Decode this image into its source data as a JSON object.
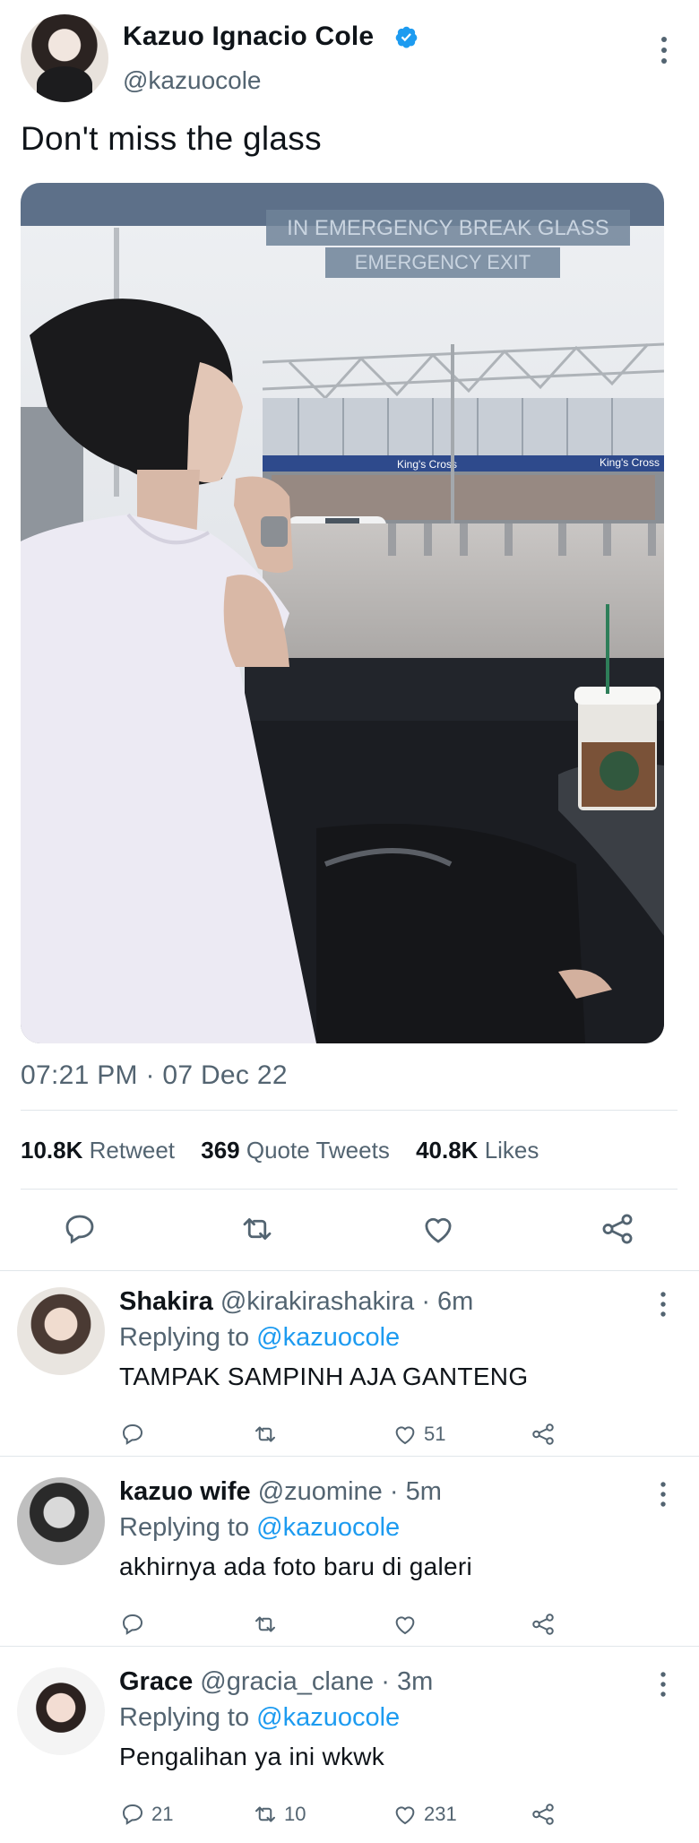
{
  "tweet": {
    "author_name": "Kazuo Ignacio Cole",
    "author_handle": "@kazuocole",
    "text": "Don't miss the glass",
    "photo_sign_1": "IN EMERGENCY BREAK GLASS",
    "photo_sign_2": "EMERGENCY EXIT",
    "photo_station_1": "King's Cross",
    "photo_station_2": "King's Cross",
    "timestamp": "07:21 PM · 07 Dec 22",
    "stats": {
      "retweets_count": "10.8K",
      "retweets_label": "Retweet",
      "quotes_count": "369",
      "quotes_label": "Quote Tweets",
      "likes_count": "40.8K",
      "likes_label": "Likes"
    },
    "icons": [
      "reply-icon",
      "retweet-icon",
      "like-icon",
      "share-icon",
      "verified-icon",
      "more-icon"
    ]
  },
  "replies": [
    {
      "name": "Shakira",
      "handle": "@kirakirashakira",
      "dot": "·",
      "time": "6m",
      "replying_label": "Replying to",
      "replying_to": "@kazuocole",
      "text": "TAMPAK SAMPINH AJA GANTENG",
      "reply_count": "",
      "retweet_count": "",
      "like_count": "51"
    },
    {
      "name": "kazuo wife",
      "handle": "@zuomine",
      "dot": "·",
      "time": "5m",
      "replying_label": "Replying to",
      "replying_to": "@kazuocole",
      "text": "akhirnya ada foto baru di galeri",
      "reply_count": "",
      "retweet_count": "",
      "like_count": ""
    },
    {
      "name": "Grace",
      "handle": "@gracia_clane",
      "dot": "·",
      "time": "3m",
      "replying_label": "Replying to",
      "replying_to": "@kazuocole",
      "text": "Pengalihan ya ini wkwk",
      "reply_count": "21",
      "retweet_count": "10",
      "like_count": "231"
    }
  ],
  "colors": {
    "accent": "#1d9bf0",
    "text_primary": "#0f1419",
    "text_secondary": "#536471",
    "divider": "#e1e6ea"
  }
}
